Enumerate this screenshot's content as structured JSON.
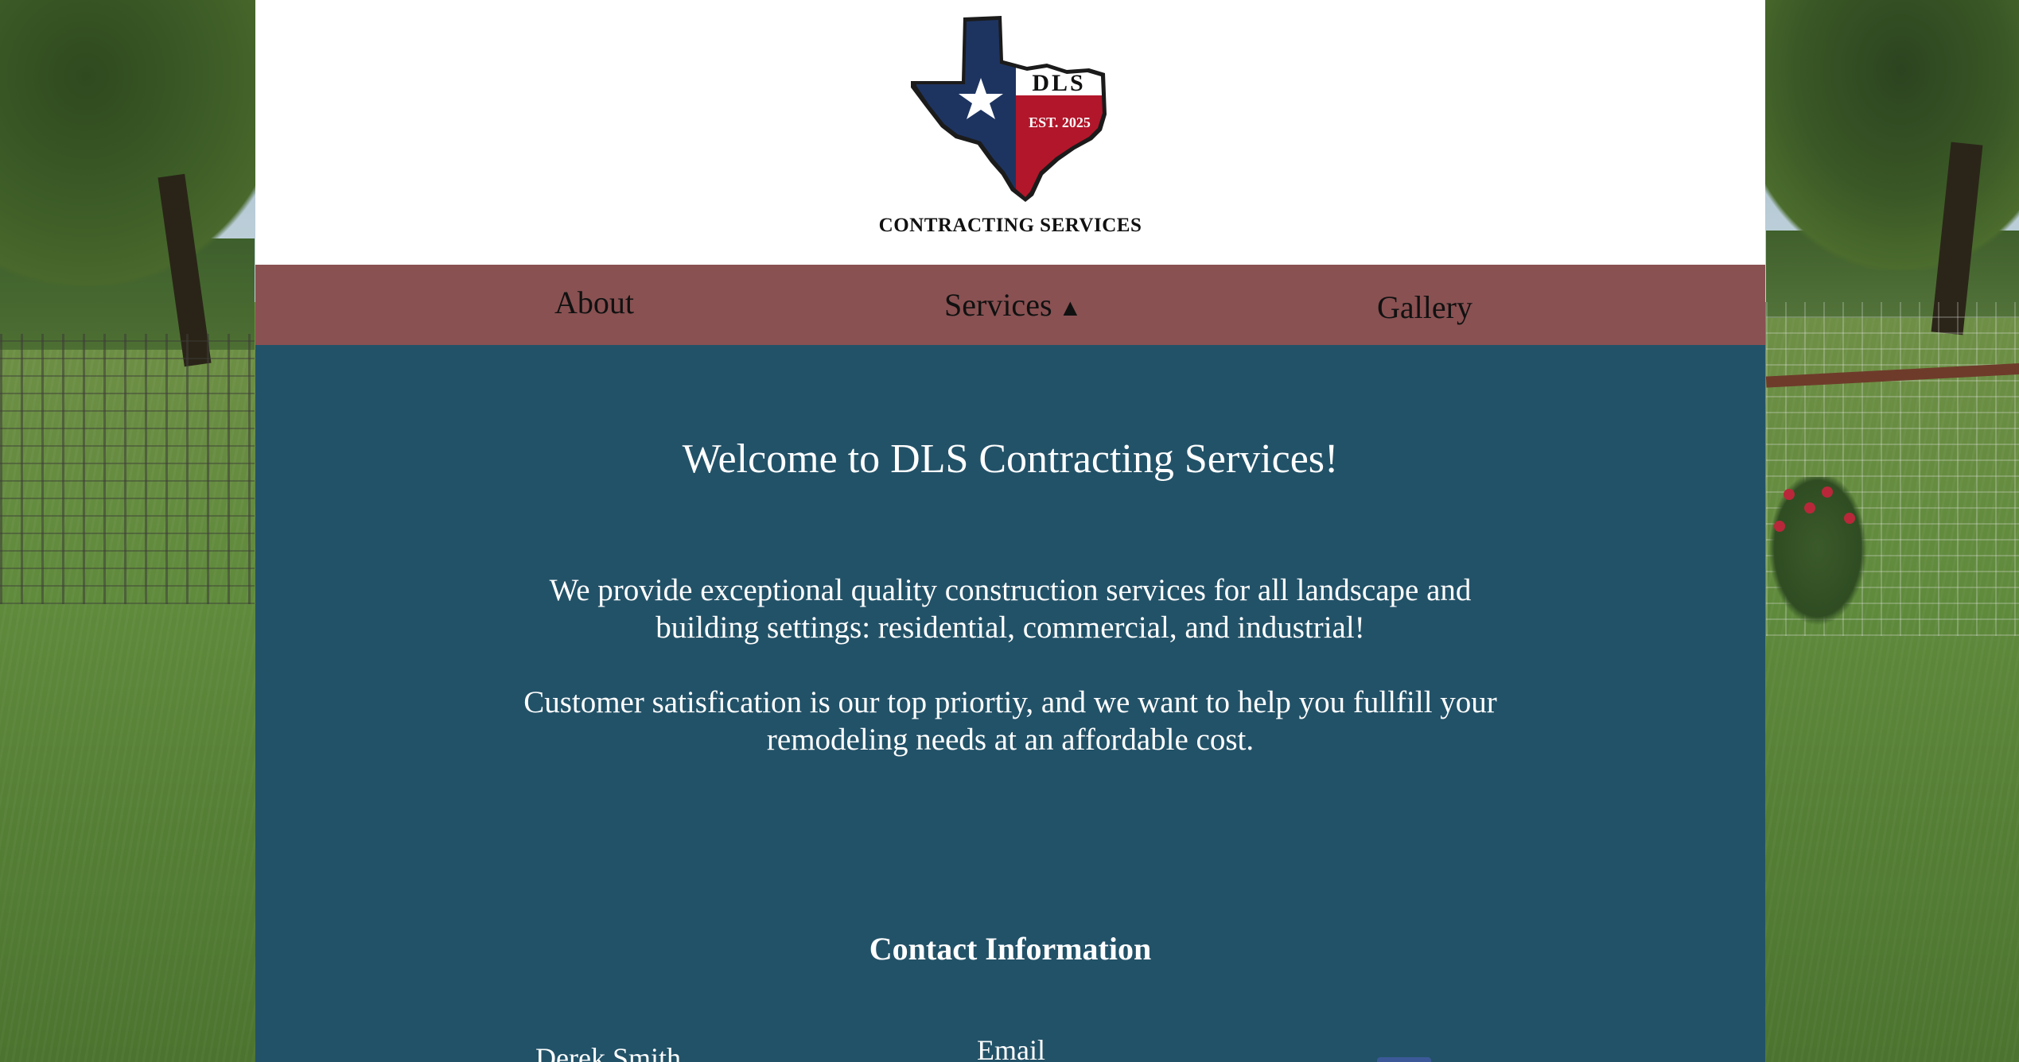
{
  "logo": {
    "initials": "DLS",
    "established": "EST. 2025",
    "caption": "CONTRACTING SERVICES",
    "colors": {
      "blue": "#1d3461",
      "red": "#b2162a",
      "white": "#ffffff",
      "outline": "#1b1b1b"
    }
  },
  "nav": {
    "items": [
      {
        "label": "About"
      },
      {
        "label": "Services",
        "arrow": "▲"
      },
      {
        "label": "Gallery"
      }
    ],
    "background": "#895152"
  },
  "main": {
    "welcome": "Welcome to DLS Contracting Services!",
    "paragraph1": "We provide exceptional quality construction services for all landscape and building settings: residential, commercial, and industrial!",
    "paragraph2": "Customer satisfication is our top priortiy, and we want to help you fullfill your remodeling needs at an affordable cost.",
    "background": "#225268"
  },
  "contact": {
    "title": "Contact Information",
    "name": "Derek Smith",
    "email_label": "Email"
  },
  "icons": {
    "star": "star-icon",
    "social": "facebook-icon"
  }
}
